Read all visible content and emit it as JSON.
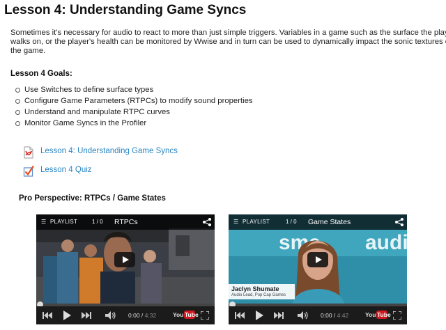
{
  "page": {
    "title": "Lesson 4: Understanding Game Syncs",
    "intro": "Sometimes it's necessary for audio to react to more than just simple triggers. Variables in a game such as the surface the player walks on, or the player's health can be monitored by Wwise and in turn can be used to dynamically impact the sonic textures of the game.",
    "goals_title": "Lesson 4 Goals:",
    "goals": [
      "Use Switches to define surface types",
      "Configure Game Parameters (RTPCs) to modify sound properties",
      "Understand and manipulate RTPC curves",
      "Monitor Game Syncs in the Profiler"
    ],
    "resources": [
      {
        "label": "Lesson 4: Understanding Game Syncs",
        "icon": "pdf-icon"
      },
      {
        "label": "Lesson 4 Quiz",
        "icon": "checkbox-quiz-icon"
      }
    ],
    "pro_title": "Pro Perspective: RTPCs / Game States"
  },
  "videos": [
    {
      "playlist_label": "PLAYLIST",
      "playlist_count": "1 / 0",
      "title": "RTPCs",
      "current_time": "0:00",
      "duration": "4:32",
      "progress": 0
    },
    {
      "playlist_label": "PLAYLIST",
      "playlist_count": "1 / 0",
      "title": "Game States",
      "current_time": "0:00",
      "duration": "4:42",
      "progress": 0,
      "lower_third_name": "Jaclyn Shumate",
      "lower_third_role": "Audio Lead, Pop Cap Games",
      "logo_text": "sma audio"
    }
  ],
  "colors": {
    "link": "#2a86c2",
    "video_bg": "#0d0d0d",
    "youtube_red": "#cc181e"
  },
  "ui": {
    "youtube_logo_text": "YouTube"
  }
}
